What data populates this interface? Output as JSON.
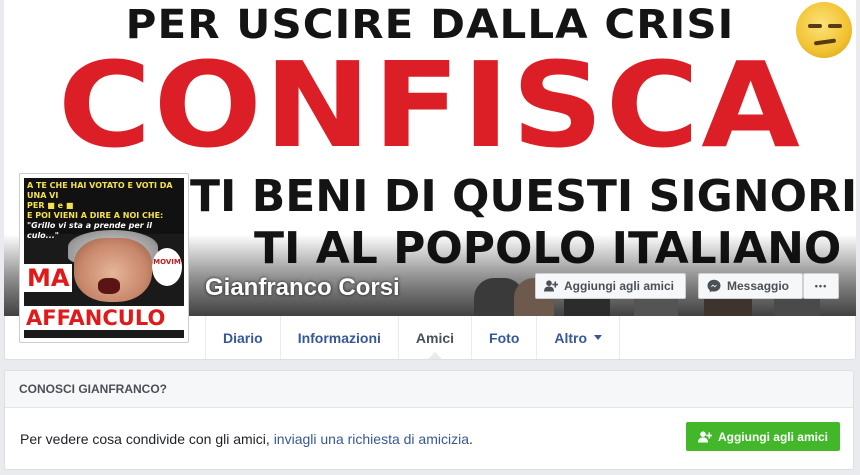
{
  "cover": {
    "line1": "PER USCIRE DALLA CRISI",
    "line2": "CONFISCA",
    "line3": "TI BENI DI QUESTI SIGNORI",
    "line4": "TI AL POPOLO ITALIANO"
  },
  "avatar": {
    "top_text": "A TE CHE HAI VOTATO E VOTI DA UNA VI",
    "top_text2": "PER",
    "top_text3": "e",
    "top_text4": "E POI VIENI A DIRE A NOI CHE:",
    "quote": "\"Grillo vi sta a prende per il culo...\"",
    "red1": "MA",
    "red2": "AFFANCULO",
    "logo": "MOVIM"
  },
  "profile": {
    "name": "Gianfranco Corsi",
    "add_friend": "Aggiungi agli amici",
    "message": "Messaggio",
    "more": "•••"
  },
  "tabs": [
    {
      "label": "Diario"
    },
    {
      "label": "Informazioni"
    },
    {
      "label": "Amici"
    },
    {
      "label": "Foto"
    },
    {
      "label": "Altro"
    }
  ],
  "know_card": {
    "header": "CONOSCI GIANFRANCO?",
    "text_before": "Per vedere cosa condivide con gli amici, ",
    "link": "inviagli una richiesta di amicizia",
    "text_after": ".",
    "button": "Aggiungi agli amici"
  },
  "colors": {
    "link": "#365899",
    "accent_green": "#42b72a",
    "cover_red": "#dc1f26"
  }
}
